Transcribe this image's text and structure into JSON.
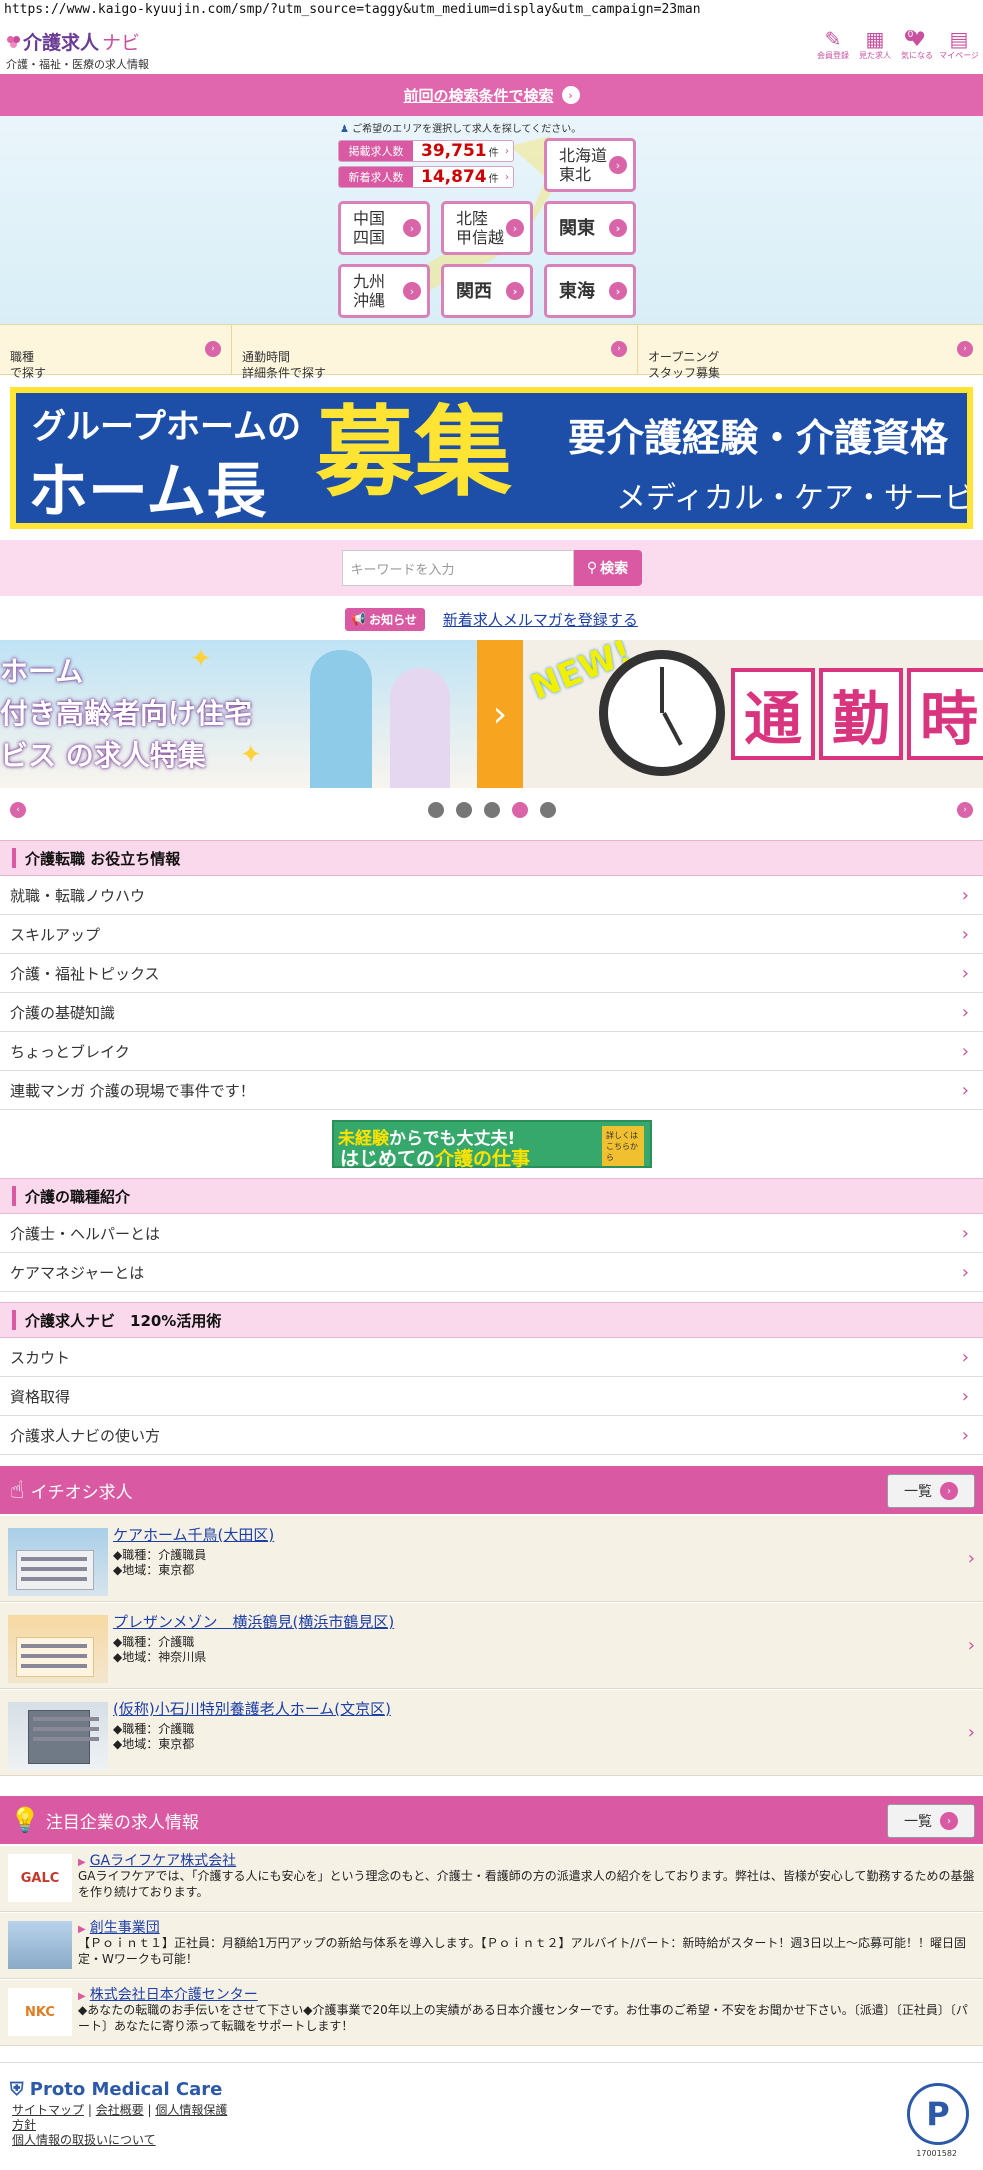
{
  "url": "https://www.kaigo-kyuujin.com/smp/?utm_source=taggy&utm_medium=display&utm_campaign=23man",
  "header": {
    "logo_main": "介護求人",
    "logo_navi": "ナビ",
    "logo_sub": "介護・福祉・医療の求人情報",
    "icons": [
      {
        "name": "pen-icon",
        "label": "会員登録"
      },
      {
        "name": "calendar-icon",
        "label": "見た求人"
      },
      {
        "name": "heart-icon",
        "label": "気になる"
      },
      {
        "name": "mypage-icon",
        "label": "マイページ"
      }
    ],
    "heart_count": "0"
  },
  "prev_search": {
    "label": "前回の検索条件で検索"
  },
  "map": {
    "hint": "ご希望のエリアを選択して求人を探してください。",
    "listed_label": "掲載求人数",
    "listed_value": "39,751",
    "new_label": "新着求人数",
    "new_value": "14,874",
    "unit": "件",
    "regions": {
      "hokkaido": "北海道\n東北",
      "chugoku": "中国\n四国",
      "hokuriku": "北陸\n甲信越",
      "kanto": "関東",
      "kyushu": "九州\n沖縄",
      "kansai": "関西",
      "tokai": "東海"
    }
  },
  "subnav": {
    "job": "職種\nで探す",
    "commute": "通勤時間\n詳細条件で探す",
    "opening": "オープニング\nスタッフ募集"
  },
  "banner1": {
    "line1": "グループホームの",
    "line2": "ホーム長",
    "big": "募集",
    "req": "要介護経験・介護資格",
    "company": "メディカル・ケア・サービス"
  },
  "search": {
    "placeholder": "キーワードを入力",
    "button": "検索"
  },
  "notice": {
    "badge": "お知らせ",
    "link": "新着求人メルマガを登録する"
  },
  "carousel": {
    "slide1": [
      "ホーム",
      "付き高齢者向け住宅",
      "ビス の求人特集"
    ],
    "new_tag": "NEW!",
    "kanji": [
      "通",
      "勤",
      "時"
    ],
    "dots": [
      false,
      false,
      false,
      true,
      false
    ]
  },
  "section_tips": {
    "title": "介護転職 お役立ち情報",
    "items": [
      "就職・転職ノウハウ",
      "スキルアップ",
      "介護・福祉トピックス",
      "介護の基礎知識",
      "ちょっとブレイク",
      "連載マンガ 介護の現場で事件です！"
    ]
  },
  "banner2": {
    "line1_hl": "未経験",
    "line1_rest": "からでも大丈夫!",
    "line2_a": "はじめての",
    "line2_hl": "介護の仕事",
    "side": "詳しくはこちらから"
  },
  "section_jobs_intro": {
    "title": "介護の職種紹介",
    "items": [
      "介護士・ヘルパーとは",
      "ケアマネジャーとは"
    ]
  },
  "section_usage": {
    "title": "介護求人ナビ　120%活用術",
    "items": [
      "スカウト",
      "資格取得",
      "介護求人ナビの使い方"
    ]
  },
  "recommended": {
    "title": "イチオシ求人",
    "more": "一覧",
    "jobs": [
      {
        "name": "ケアホーム千鳥(大田区)",
        "type": "◆職種：介護職員",
        "area": "◆地域：東京都"
      },
      {
        "name": "プレザンメゾン　横浜鶴見(横浜市鶴見区)",
        "type": "◆職種：介護職",
        "area": "◆地域：神奈川県"
      },
      {
        "name": "(仮称)小石川特別養護老人ホーム(文京区)",
        "type": "◆職種：介護職",
        "area": "◆地域：東京都"
      }
    ]
  },
  "companies": {
    "title": "注目企業の求人情報",
    "more": "一覧",
    "items": [
      {
        "logo": "GALC",
        "name": "GAライフケア株式会社",
        "desc": "GAライフケアでは、「介護する人にも安心を」という理念のもと、介護士・看護師の方の派遣求人の紹介をしております。弊社は、皆様が安心して勤務するための基盤を作り続けております。"
      },
      {
        "logo": "",
        "name": "創生事業団",
        "desc": "【Ｐｏｉｎｔ１】正社員：月額給1万円アップの新給与体系を導入します。【Ｐｏｉｎｔ２】アルバイト/パート：新時給がスタート！週3日以上～応募可能！！曜日固定・Wワークも可能！"
      },
      {
        "logo": "NKC",
        "name": "株式会社日本介護センター",
        "desc": "◆あなたの転職のお手伝いをさせて下さい◆介護事業で20年以上の実績がある日本介護センターです。お仕事のご希望・不安をお聞かせ下さい。〔派遣〕〔正社員〕〔パート〕あなたに寄り添って転職をサポートします！"
      }
    ]
  },
  "footer": {
    "brand": "Proto Medical Care",
    "links": [
      "サイトマップ",
      "会社概要",
      "個人情報保護",
      "方針",
      "個人情報の取扱いについて"
    ],
    "privacy_mark": "P",
    "privacy_no": "17001582"
  }
}
